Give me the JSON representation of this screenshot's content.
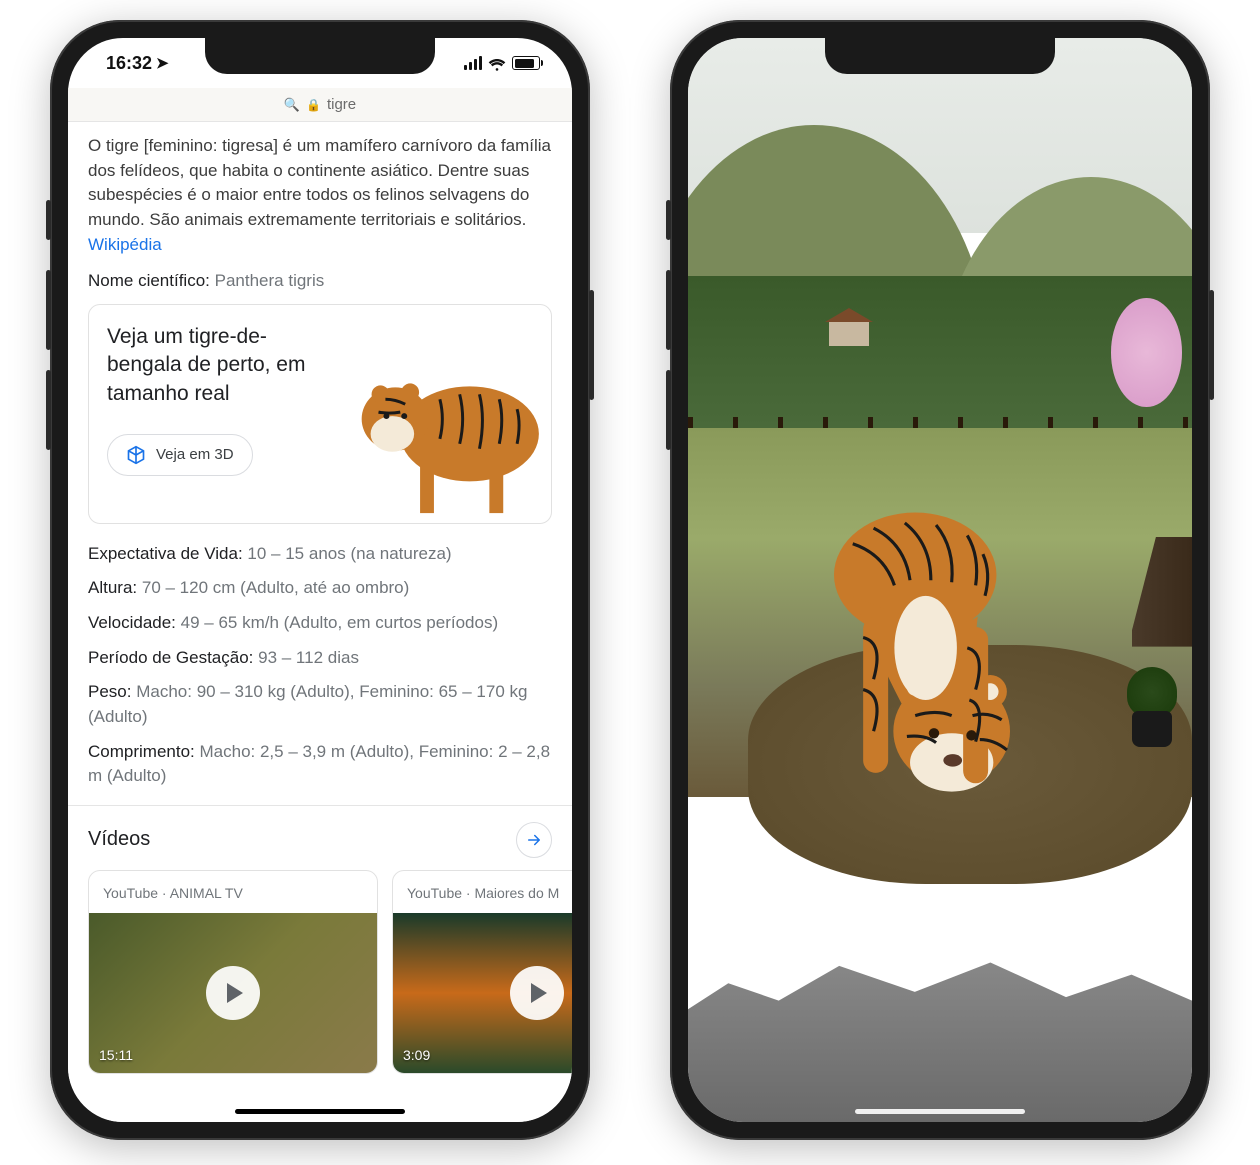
{
  "left": {
    "status": {
      "time": "16:32"
    },
    "url": {
      "query": "tigre"
    },
    "description": "O tigre [feminino: tigresa] é um mamífero carnívoro da família dos felídeos, que habita o continente asiático. Dentre suas subespécies é o maior entre todos os felinos selvagens do mundo. São animais extremamente territoriais e solitários.",
    "wiki_link": "Wikipédia",
    "sci_name_label": "Nome científico:",
    "sci_name_value": "Panthera tigris",
    "ar_card": {
      "title": "Veja um tigre-de-bengala de perto, em tamanho real",
      "button": "Veja em 3D"
    },
    "facts": [
      {
        "label": "Expectativa de Vida:",
        "value": "10 – 15 anos (na natureza)"
      },
      {
        "label": "Altura:",
        "value": "70 – 120 cm (Adulto, até ao ombro)"
      },
      {
        "label": "Velocidade:",
        "value": "49 – 65 km/h (Adulto, em curtos períodos)"
      },
      {
        "label": "Período de Gestação:",
        "value": "93 – 112 dias"
      },
      {
        "label": "Peso:",
        "value": "Macho: 90 – 310 kg (Adulto), Feminino: 65 – 170 kg (Adulto)"
      },
      {
        "label": "Comprimento:",
        "value": "Macho: 2,5 – 3,9 m (Adulto), Feminino: 2 – 2,8 m (Adulto)"
      }
    ],
    "videos_header": "Vídeos",
    "videos": [
      {
        "source": "YouTube",
        "channel": "ANIMAL TV",
        "duration": "15:11"
      },
      {
        "source": "YouTube",
        "channel": "Maiores do M",
        "duration": "3:09"
      }
    ]
  }
}
